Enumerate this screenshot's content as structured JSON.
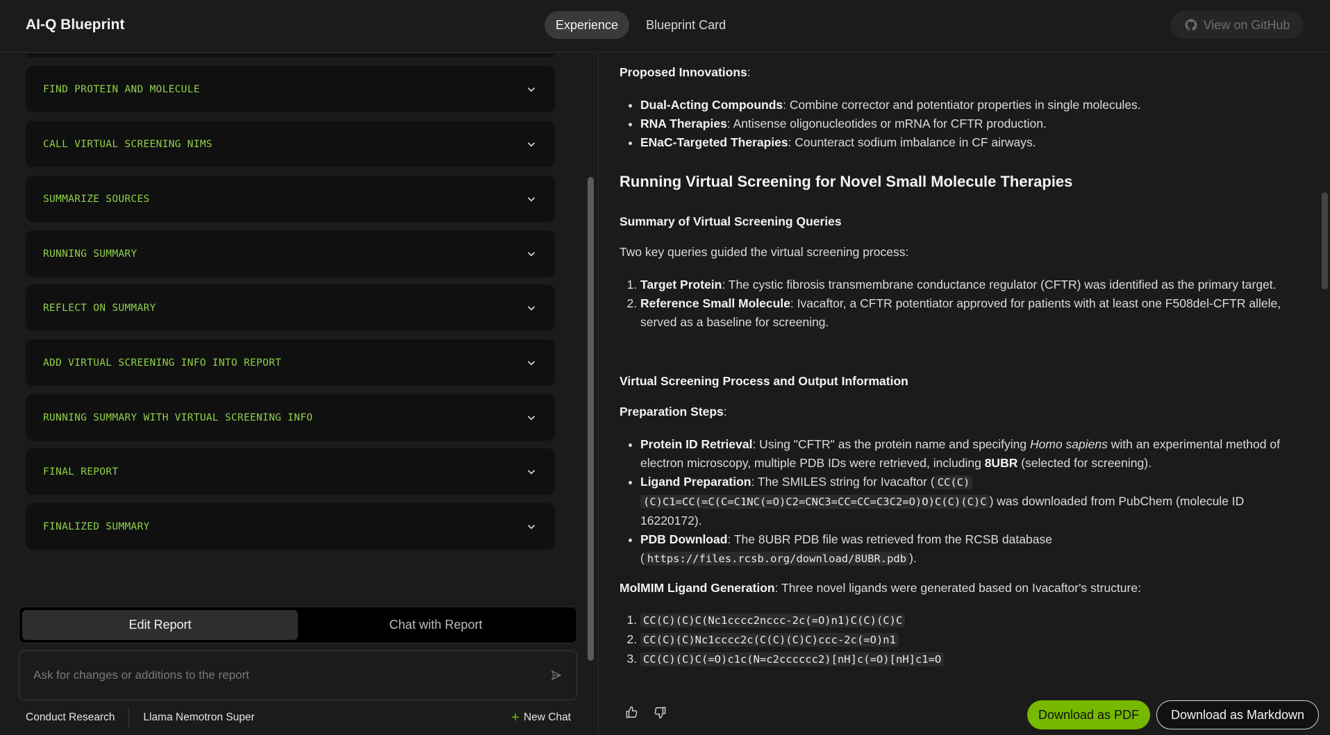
{
  "app": {
    "title": "AI-Q Blueprint"
  },
  "header": {
    "tabs": [
      "Experience",
      "Blueprint Card"
    ],
    "active_tab": "Experience",
    "github_label": "View on GitHub"
  },
  "steps": [
    "FIND PROTEIN AND MOLECULE",
    "CALL VIRTUAL SCREENING NIMS",
    "SUMMARIZE SOURCES",
    "RUNNING SUMMARY",
    "REFLECT ON SUMMARY",
    "ADD VIRTUAL SCREENING INFO INTO REPORT",
    "RUNNING SUMMARY WITH VIRTUAL SCREENING INFO",
    "FINAL REPORT",
    "FINALIZED SUMMARY"
  ],
  "mode_toggle": {
    "edit": "Edit Report",
    "chat": "Chat with Report",
    "active": "Edit Report"
  },
  "ask": {
    "placeholder": "Ask for changes or additions to the report"
  },
  "footer": {
    "mode": "Conduct Research",
    "model": "Llama Nemotron Super",
    "new_chat": "New Chat"
  },
  "report": {
    "innov_title": "Proposed Innovations",
    "innov": [
      {
        "term": "Dual-Acting Compounds",
        "text": ": Combine corrector and potentiator properties in single molecules."
      },
      {
        "term": "RNA Therapies",
        "text": ": Antisense oligonucleotides or mRNA for CFTR production."
      },
      {
        "term": "ENaC-Targeted Therapies",
        "text": ": Counteract sodium imbalance in CF airways."
      }
    ],
    "h2": "Running Virtual Screening for Novel Small Molecule Therapies",
    "h3_queries": "Summary of Virtual Screening Queries",
    "queries_intro": "Two key queries guided the virtual screening process:",
    "queries": [
      {
        "term": "Target Protein",
        "text": ": The cystic fibrosis transmembrane conductance regulator (CFTR) was identified as the primary target."
      },
      {
        "term": "Reference Small Molecule",
        "text": ": Ivacaftor, a CFTR potentiator approved for patients with at least one F508del-CFTR allele, served as a baseline for screening."
      }
    ],
    "h3_process": "Virtual Screening Process and Output Information",
    "prep_title": "Preparation Steps",
    "prep": {
      "p1_term": "Protein ID Retrieval",
      "p1_a": ": Using \"CFTR\" as the protein name and specifying ",
      "p1_em": "Homo sapiens",
      "p1_b": " with an experimental method of electron microscopy, multiple PDB IDs were retrieved, including ",
      "p1_bold": "8UBR",
      "p1_c": " (selected for screening).",
      "p2_term": "Ligand Preparation",
      "p2_a": ": The SMILES string for Ivacaftor (",
      "p2_code1": "CC(C)",
      "p2_code2": "(C)C1=CC(=C(C=C1NC(=O)C2=CNC3=CC=CC=C3C2=O)O)C(C)(C)C",
      "p2_b": ") was downloaded from PubChem (molecule ID 16220172).",
      "p3_term": "PDB Download",
      "p3_a": ": The 8UBR PDB file was retrieved from the RCSB database (",
      "p3_code": "https://files.rcsb.org/download/8UBR.pdb",
      "p3_b": ")."
    },
    "molmim_title": "MolMIM Ligand Generation",
    "molmim_text": ": Three novel ligands were generated based on Ivacaftor's structure:",
    "ligands": [
      "CC(C)(C)C(Nc1cccc2nccc-2c(=O)n1)C(C)(C)C",
      "CC(C)(C)Nc1cccc2c(C(C)(C)C)ccc-2c(=O)n1",
      "CC(C)(C)C(=O)c1c(N=c2cccccc2)[nH]c(=O)[nH]c1=O"
    ]
  },
  "actions": {
    "pdf": "Download as PDF",
    "markdown": "Download as Markdown"
  }
}
